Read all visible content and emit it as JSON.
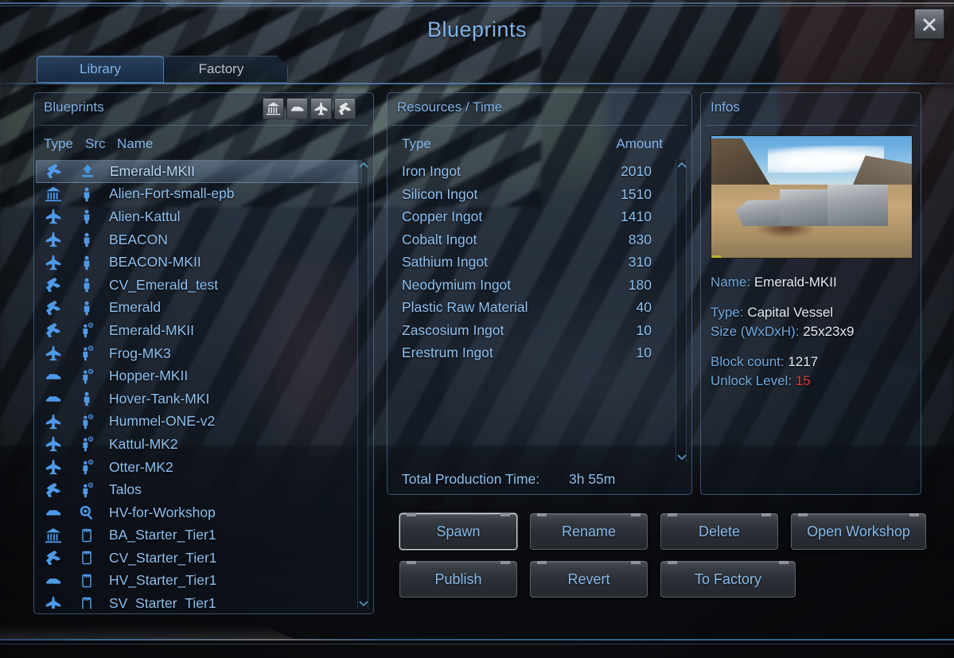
{
  "window": {
    "title": "Blueprints",
    "close_icon": "close-icon"
  },
  "tabs": [
    {
      "label": "Library",
      "active": true
    },
    {
      "label": "Factory",
      "active": false
    }
  ],
  "blueprints_panel": {
    "title": "Blueprints",
    "filters": [
      {
        "name": "filter-base",
        "icon": "base-icon"
      },
      {
        "name": "filter-hover-vessel",
        "icon": "hover-vessel-icon"
      },
      {
        "name": "filter-small-vessel",
        "icon": "small-vessel-icon"
      },
      {
        "name": "filter-capital-vessel",
        "icon": "capital-vessel-icon"
      }
    ],
    "columns": {
      "type": "Type",
      "src": "Src",
      "name": "Name"
    },
    "rows": [
      {
        "type": "capital-vessel-icon",
        "src": "upload-icon",
        "name": "Emerald-MKII",
        "selected": true
      },
      {
        "type": "base-icon",
        "src": "person-icon",
        "name": "Alien-Fort-small-epb",
        "selected": false
      },
      {
        "type": "small-vessel-icon",
        "src": "person-icon",
        "name": "Alien-Kattul",
        "selected": false
      },
      {
        "type": "small-vessel-icon",
        "src": "person-icon",
        "name": "BEACON",
        "selected": false
      },
      {
        "type": "small-vessel-icon",
        "src": "person-icon",
        "name": "BEACON-MKII",
        "selected": false
      },
      {
        "type": "capital-vessel-icon",
        "src": "person-icon",
        "name": "CV_Emerald_test",
        "selected": false
      },
      {
        "type": "capital-vessel-icon",
        "src": "person-icon",
        "name": "Emerald",
        "selected": false
      },
      {
        "type": "capital-vessel-icon",
        "src": "person-steam-icon",
        "name": "Emerald-MKII",
        "selected": false
      },
      {
        "type": "small-vessel-icon",
        "src": "person-steam-icon",
        "name": "Frog-MK3",
        "selected": false
      },
      {
        "type": "hover-vessel-icon",
        "src": "person-steam-icon",
        "name": "Hopper-MKII",
        "selected": false
      },
      {
        "type": "hover-vessel-icon",
        "src": "person-icon",
        "name": "Hover-Tank-MKI",
        "selected": false
      },
      {
        "type": "small-vessel-icon",
        "src": "person-steam-icon",
        "name": "Hummel-ONE-v2",
        "selected": false
      },
      {
        "type": "small-vessel-icon",
        "src": "person-steam-icon",
        "name": "Kattul-MK2",
        "selected": false
      },
      {
        "type": "small-vessel-icon",
        "src": "person-steam-icon",
        "name": "Otter-MK2",
        "selected": false
      },
      {
        "type": "capital-vessel-icon",
        "src": "person-steam-icon",
        "name": "Talos",
        "selected": false
      },
      {
        "type": "hover-vessel-icon",
        "src": "workshop-icon",
        "name": "HV-for-Workshop",
        "selected": false
      },
      {
        "type": "base-icon",
        "src": "card-icon",
        "name": "BA_Starter_Tier1",
        "selected": false
      },
      {
        "type": "capital-vessel-icon",
        "src": "card-icon",
        "name": "CV_Starter_Tier1",
        "selected": false
      },
      {
        "type": "hover-vessel-icon",
        "src": "card-icon",
        "name": "HV_Starter_Tier1",
        "selected": false
      },
      {
        "type": "small-vessel-icon",
        "src": "card-icon",
        "name": "SV_Starter_Tier1",
        "selected": false
      }
    ]
  },
  "resources_panel": {
    "title": "Resources / Time",
    "columns": {
      "type": "Type",
      "amount": "Amount"
    },
    "rows": [
      {
        "type": "Iron Ingot",
        "amount": "2010"
      },
      {
        "type": "Silicon Ingot",
        "amount": "1510"
      },
      {
        "type": "Copper Ingot",
        "amount": "1410"
      },
      {
        "type": "Cobalt Ingot",
        "amount": "830"
      },
      {
        "type": "Sathium Ingot",
        "amount": "310"
      },
      {
        "type": "Neodymium Ingot",
        "amount": "180"
      },
      {
        "type": "Plastic Raw Material",
        "amount": "40"
      },
      {
        "type": "Zascosium Ingot",
        "amount": "10"
      },
      {
        "type": "Erestrum Ingot",
        "amount": "10"
      }
    ],
    "total_label": "Total Production Time:",
    "total_value": "3h 55m"
  },
  "infos_panel": {
    "title": "Infos",
    "name_label": "Name:",
    "name_value": "Emerald-MKII",
    "type_label": "Type:",
    "type_value": "Capital Vessel",
    "size_label": "Size (WxDxH):",
    "size_value": "25x23x9",
    "block_label": "Block count:",
    "block_value": "1217",
    "unlock_label": "Unlock Level:",
    "unlock_value": "15",
    "unlock_color": "#e03a3a"
  },
  "actions": {
    "row1": [
      {
        "label": "Spawn",
        "highlight": true
      },
      {
        "label": "Rename",
        "highlight": false
      },
      {
        "label": "Delete",
        "highlight": false
      },
      {
        "label": "Open Workshop",
        "highlight": false
      }
    ],
    "row2": [
      {
        "label": "Publish",
        "highlight": false
      },
      {
        "label": "Revert",
        "highlight": false
      },
      {
        "label": "To Factory",
        "highlight": false
      }
    ]
  },
  "colors": {
    "accent_blue": "#7fb2e8",
    "text_blue": "#8cc0f0",
    "value_white": "#e3eaf2",
    "alert_red": "#e03a3a",
    "panel_border": "#5c88b6"
  }
}
